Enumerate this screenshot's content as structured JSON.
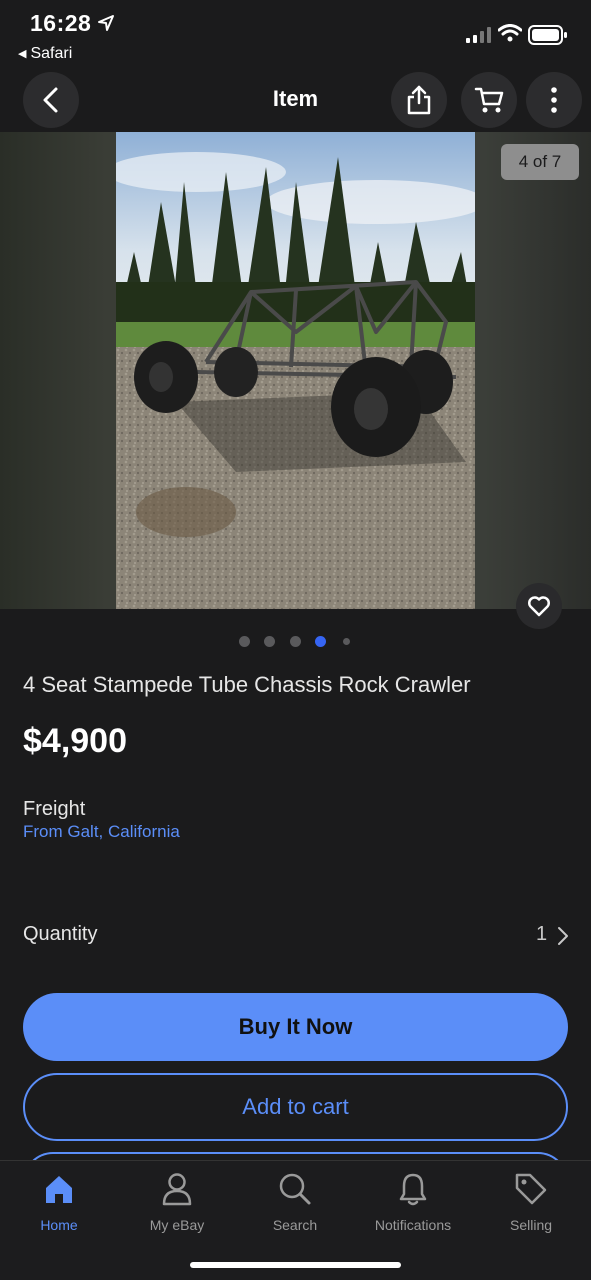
{
  "status": {
    "time": "16:28",
    "back_app": "Safari"
  },
  "nav": {
    "title": "Item"
  },
  "gallery": {
    "counter": "4 of 7",
    "dots_total": 5,
    "active_dot": 4
  },
  "item": {
    "title": "4 Seat Stampede Tube Chassis Rock Crawler",
    "price": "$4,900",
    "shipping_label": "Freight",
    "location": "From Galt, California"
  },
  "quantity": {
    "label": "Quantity",
    "value": "1"
  },
  "actions": {
    "buy_now": "Buy It Now",
    "add_to_cart": "Add to cart"
  },
  "tabbar": {
    "items": [
      {
        "label": "Home",
        "icon": "home-icon",
        "active": true
      },
      {
        "label": "My eBay",
        "icon": "person-icon",
        "active": false
      },
      {
        "label": "Search",
        "icon": "search-icon",
        "active": false
      },
      {
        "label": "Notifications",
        "icon": "bell-icon",
        "active": false
      },
      {
        "label": "Selling",
        "icon": "tag-icon",
        "active": false
      }
    ]
  },
  "colors": {
    "background": "#1b1b1c",
    "accent": "#5b8ef8",
    "active_dot": "#3665f3"
  }
}
